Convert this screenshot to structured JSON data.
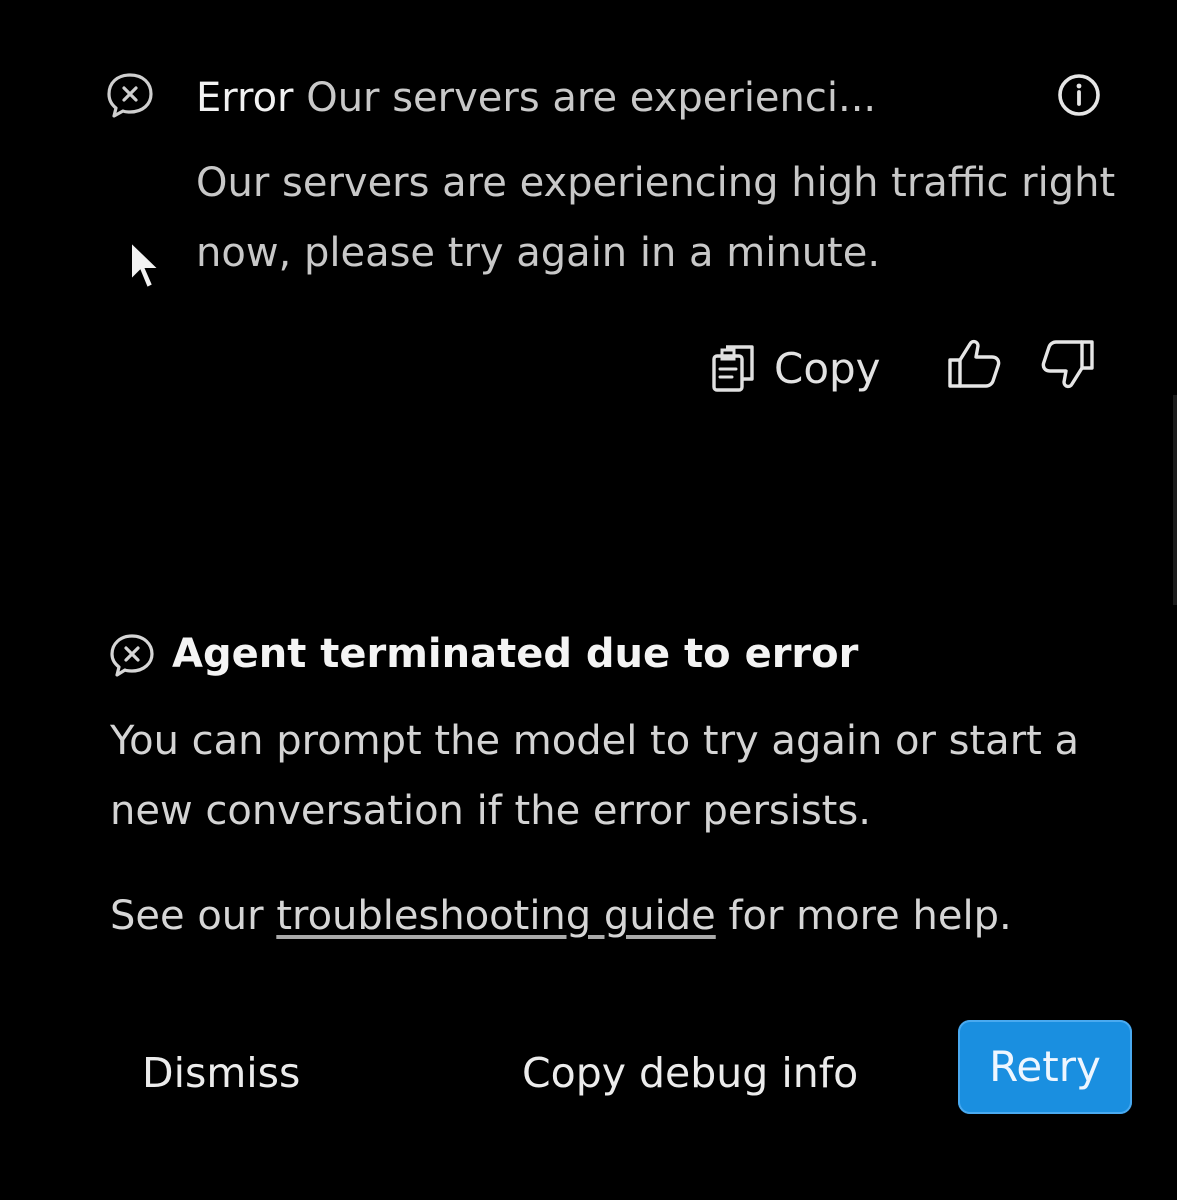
{
  "error_header": {
    "label": "Error",
    "preview": "Our servers are experienci...",
    "icon": "error-bubble-icon",
    "info_icon": "info-icon"
  },
  "error_body": {
    "message": "Our servers are experiencing high traffic right now, please try again in a minute."
  },
  "feedback": {
    "copy_label": "Copy",
    "copy_icon": "copy-icon",
    "thumbs_up_icon": "thumbs-up-icon",
    "thumbs_down_icon": "thumbs-down-icon"
  },
  "termination": {
    "icon": "error-bubble-icon",
    "title": "Agent terminated due to error",
    "body": "You can prompt the model to try again or start a new conversation if the error persists.",
    "help_prefix": "See our ",
    "help_link": "troubleshooting guide",
    "help_suffix": " for more help."
  },
  "actions": {
    "dismiss_label": "Dismiss",
    "debug_label": "Copy debug info",
    "retry_label": "Retry"
  },
  "colors": {
    "background": "#000000",
    "retry_button": "#1a8fe0"
  }
}
